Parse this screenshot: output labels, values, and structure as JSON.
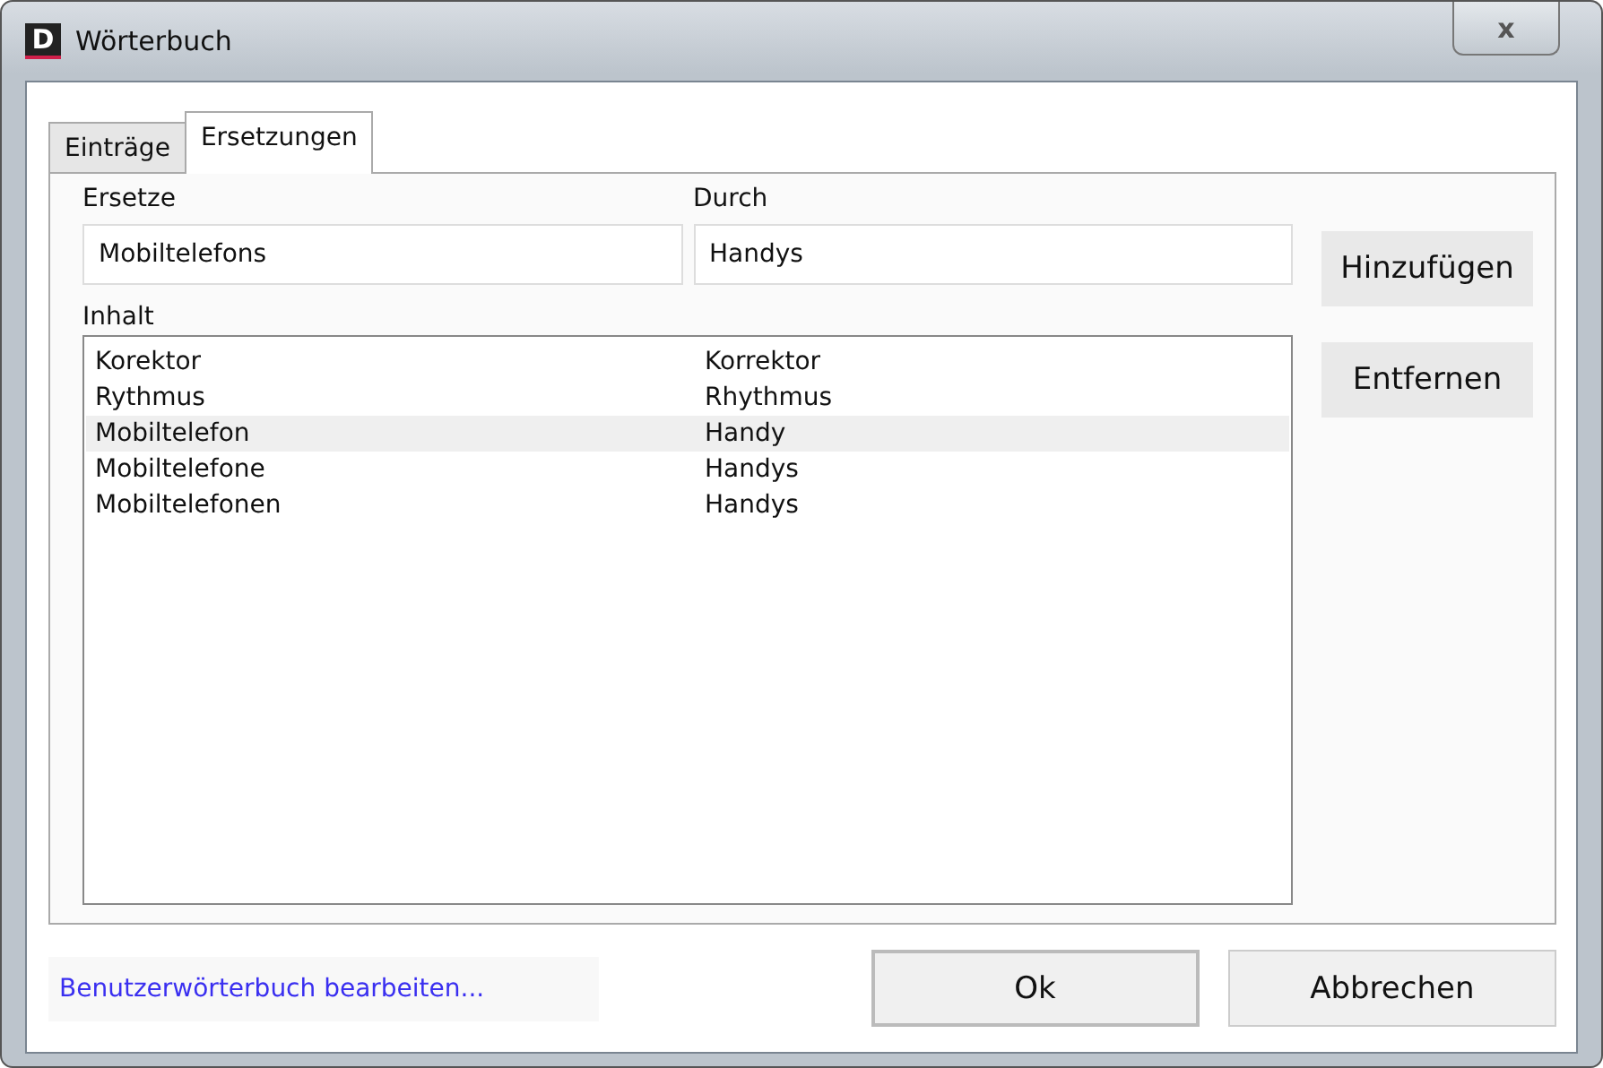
{
  "window": {
    "title": "Wörterbuch",
    "app_letter": "D",
    "close": "x"
  },
  "tabs": [
    {
      "label": "Einträge",
      "selected": false
    },
    {
      "label": "Ersetzungen",
      "selected": true
    }
  ],
  "replace": {
    "label": "Ersetze",
    "value": "Mobiltelefons"
  },
  "with": {
    "label": "Durch",
    "value": "Handys"
  },
  "add_button": "Hinzufügen",
  "remove_button": "Entfernen",
  "content": {
    "label": "Inhalt",
    "rows": [
      {
        "from": "Korektor",
        "to": "Korrektor",
        "selected": false
      },
      {
        "from": "Rythmus",
        "to": "Rhythmus",
        "selected": false
      },
      {
        "from": "Mobiltelefon",
        "to": "Handy",
        "selected": true
      },
      {
        "from": "Mobiltelefone",
        "to": "Handys",
        "selected": false
      },
      {
        "from": "Mobiltelefonen",
        "to": "Handys",
        "selected": false
      }
    ]
  },
  "edit_link": "Benutzerwörterbuch bearbeiten...",
  "buttons": [
    "Ok",
    "Abbrechen"
  ]
}
